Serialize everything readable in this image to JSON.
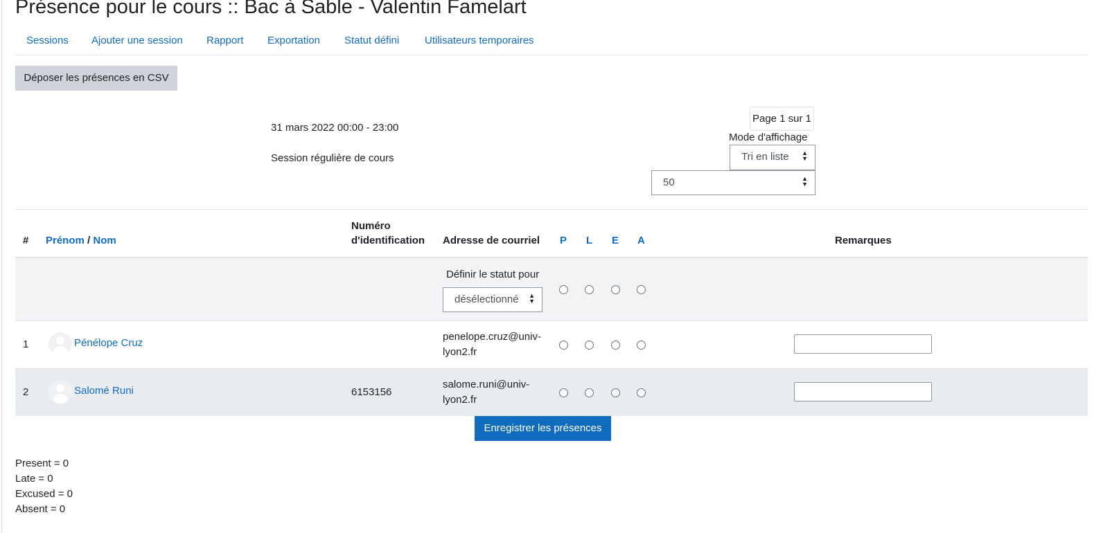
{
  "page_title": "Présence pour le cours :: Bac à Sable - Valentin Famelart",
  "tabs": [
    "Sessions",
    "Ajouter une session",
    "Rapport",
    "Exportation",
    "Statut défini",
    "Utilisateurs temporaires"
  ],
  "csv_button": "Déposer les présences en CSV",
  "session": {
    "date": "31 mars 2022 00:00 - 23:00",
    "description": "Session régulière de cours"
  },
  "pager": "Page 1 sur 1",
  "view_mode": {
    "label": "Mode d'affichage",
    "selected": "Tri en liste"
  },
  "per_page": "50",
  "table": {
    "hash": "#",
    "firstname": "Prénom",
    "slash": "/",
    "lastname": "Nom",
    "id_line1": "Numéro",
    "id_line2": "d'identification",
    "email": "Adresse de courriel",
    "statuses": [
      "P",
      "L",
      "E",
      "A"
    ],
    "remarks": "Remarques"
  },
  "bulk": {
    "label": "Définir le statut pour",
    "selected": "désélectionné"
  },
  "students": [
    {
      "num": "1",
      "name": "Pénélope Cruz",
      "idnumber": "",
      "email_line1": "penelope.cruz@univ-",
      "email_line2": "lyon2.fr"
    },
    {
      "num": "2",
      "name": "Salomé Runi",
      "idnumber": "6153156",
      "email_line1": "salome.runi@univ-",
      "email_line2": "lyon2.fr"
    }
  ],
  "save_button": "Enregistrer les présences",
  "summary": [
    "Present = 0",
    "Late = 0",
    "Excused = 0",
    "Absent = 0"
  ],
  "colors": {
    "link": "#0f6cbf",
    "primary_button": "#0f6cbf",
    "secondary_button": "#ced4da",
    "row_shade": "#e9ecef"
  }
}
